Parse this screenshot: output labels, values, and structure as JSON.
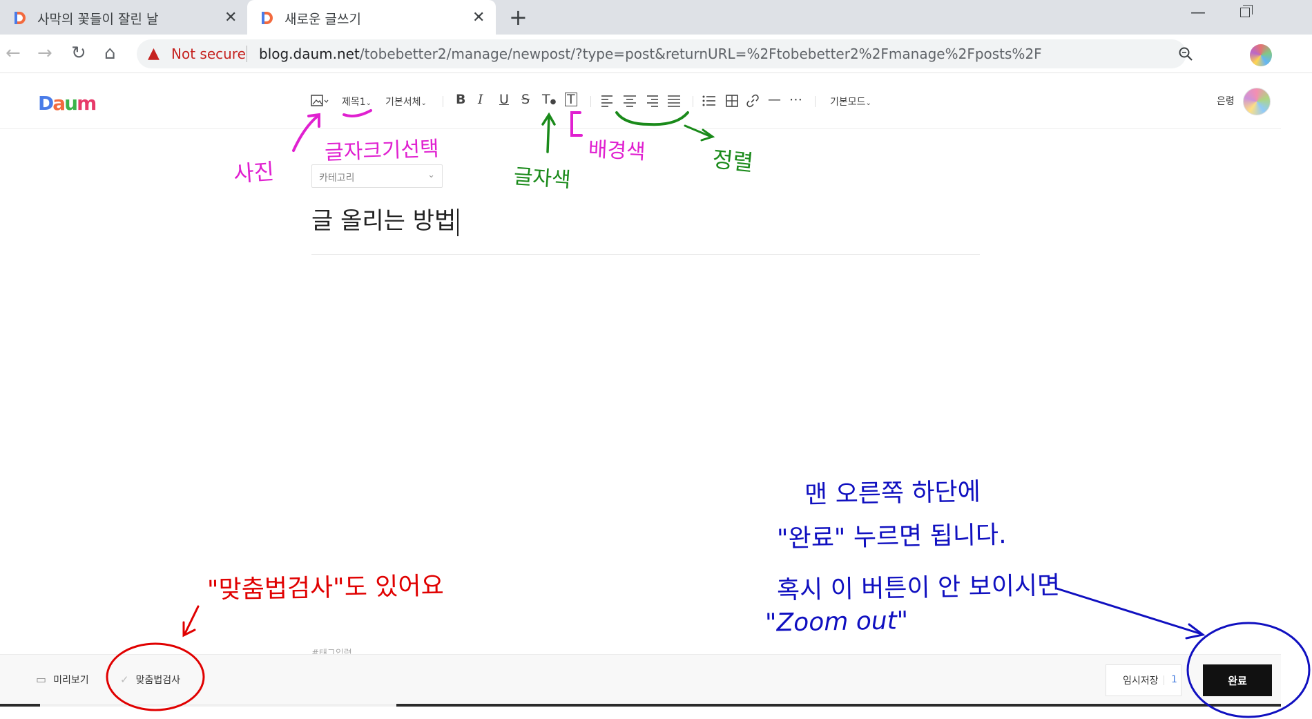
{
  "browser": {
    "tabs": [
      {
        "title": "사막의 꽃들이 잘린 날",
        "close": "✕"
      },
      {
        "title": "새로운 글쓰기",
        "close": "✕"
      }
    ],
    "new_tab": "+",
    "minimize": "—",
    "address": {
      "warning": "Not secure",
      "host": "blog.daum.net",
      "path": "/tobebetter2/manage/newpost/?type=post&returnURL=%2Ftobebetter2%2Fmanage%2Fposts%2F"
    }
  },
  "editor": {
    "logo": [
      "D",
      "a",
      "u",
      "m"
    ],
    "toolbar": {
      "heading": "제목1",
      "font": "기본서체",
      "bold": "B",
      "italic": "I",
      "underline": "U",
      "strike": "S",
      "text_color": "T",
      "bg_color": "T",
      "mode": "기본모드"
    },
    "user_name": "은령",
    "category_placeholder": "카테고리",
    "post_title": "글 올리는 방법",
    "tag_placeholder": "#태그입력"
  },
  "bottom": {
    "preview": "미리보기",
    "spellcheck": "맞춤법검사",
    "save_draft": "임시저장",
    "draft_count": "1",
    "done": "완료"
  },
  "annotations": {
    "photo": "사진",
    "font_size": "글자크기선택",
    "text_color": "글자색",
    "bg_color": "배경색",
    "align": "정렬",
    "spellcheck_note": "\"맞춤법검사\"도 있어요",
    "right_note_1": "맨 오른쪽 하단에",
    "right_note_2": "\"완료\" 누르면 됩니다.",
    "right_note_3": "혹시 이 버튼이 안 보이시면",
    "right_note_4": "\"Zoom out\""
  },
  "colors": {
    "magenta_ink": "#e020d0",
    "green_ink": "#1a8a1a",
    "red_ink": "#e00000",
    "blue_ink": "#1010c0",
    "done_button": "#111111"
  }
}
